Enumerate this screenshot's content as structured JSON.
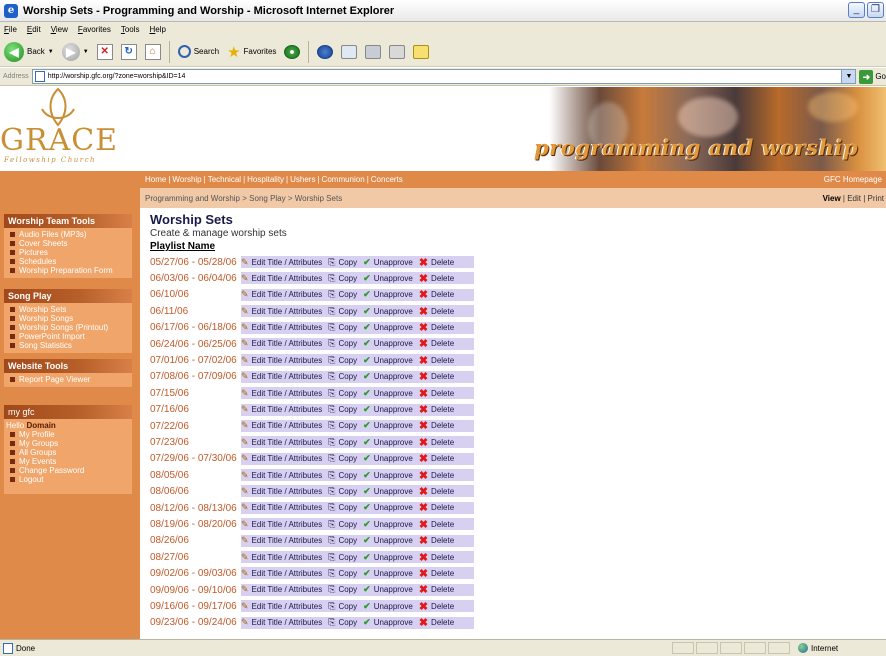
{
  "window": {
    "title": "Worship Sets - Programming and Worship - Microsoft Internet Explorer",
    "menu": [
      "File",
      "Edit",
      "View",
      "Favorites",
      "Tools",
      "Help"
    ],
    "toolbar": {
      "back": "Back",
      "search": "Search",
      "favorites": "Favorites"
    },
    "address_label": "Address",
    "url": "http://worship.gfc.org/?zone=worship&ID=14",
    "go_label": "Go",
    "status_text": "Done",
    "zone_text": "Internet"
  },
  "header": {
    "logo_text": "GRACE",
    "logo_sub": "Fellowship Church",
    "banner_text": "programming and worship"
  },
  "nav": {
    "links": [
      "Home",
      "Worship",
      "Technical",
      "Hospitality",
      "Ushers",
      "Communion",
      "Concerts"
    ],
    "right_link": "GFC Homepage"
  },
  "breadcrumb": {
    "items": [
      "Programming and Worship",
      "Song Play",
      "Worship Sets"
    ],
    "view": "View",
    "edit": "Edit",
    "print": "Print"
  },
  "sidebar": {
    "sections": [
      {
        "title": "Worship Team Tools",
        "items": [
          "Audio Files (MP3s)",
          "Cover Sheets",
          "Pictures",
          "Schedules",
          "Worship Preparation Form"
        ]
      },
      {
        "title": "Song Play",
        "items": [
          "Worship Sets",
          "Worship Songs",
          "Worship Songs (Printout)",
          "PowerPoint Import",
          "Song Statistics"
        ]
      },
      {
        "title": "Website Tools",
        "items": [
          "Report Page Viewer"
        ]
      },
      {
        "title": "my gfc",
        "hello": "Hello",
        "user": "Domain",
        "items": [
          "My Profile",
          "My Groups",
          "All Groups",
          "My Events",
          "Change Password",
          "Logout"
        ]
      }
    ]
  },
  "main": {
    "title": "Worship Sets",
    "subtitle": "Create & manage worship sets",
    "column_header": "Playlist Name",
    "actions": {
      "edit": "Edit Title / Attributes",
      "copy": "Copy",
      "unapprove": "Unapprove",
      "delete": "Delete"
    },
    "playlists": [
      "05/27/06 - 05/28/06",
      "06/03/06 - 06/04/06",
      "06/10/06",
      "06/11/06",
      "06/17/06 - 06/18/06",
      "06/24/06 - 06/25/06",
      "07/01/06 - 07/02/06",
      "07/08/06 - 07/09/06",
      "07/15/06",
      "07/16/06",
      "07/22/06",
      "07/23/06",
      "07/29/06 - 07/30/06",
      "08/05/06",
      "08/06/06",
      "08/12/06 - 08/13/06",
      "08/19/06 - 08/20/06",
      "08/26/06",
      "08/27/06",
      "09/02/06 - 09/03/06",
      "09/09/06 - 09/10/06",
      "09/16/06 - 09/17/06",
      "09/23/06 - 09/24/06"
    ]
  },
  "colors": {
    "orange": "#e08a4a",
    "peach": "#f1c9a7",
    "accent_date": "#c05a2a",
    "action_bg": "#d8d0f0"
  }
}
